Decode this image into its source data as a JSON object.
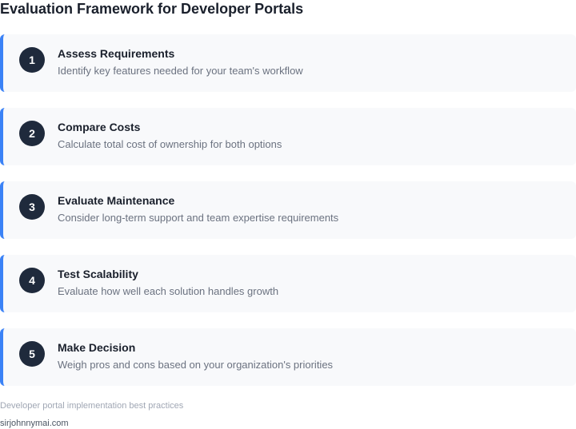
{
  "title": "Evaluation Framework for Developer Portals",
  "steps": [
    {
      "number": "1",
      "title": "Assess Requirements",
      "description": "Identify key features needed for your team's workflow"
    },
    {
      "number": "2",
      "title": "Compare Costs",
      "description": "Calculate total cost of ownership for both options"
    },
    {
      "number": "3",
      "title": "Evaluate Maintenance",
      "description": "Consider long-term support and team expertise requirements"
    },
    {
      "number": "4",
      "title": "Test Scalability",
      "description": "Evaluate how well each solution handles growth"
    },
    {
      "number": "5",
      "title": "Make Decision",
      "description": "Weigh pros and cons based on your organization's priorities"
    }
  ],
  "caption": "Developer portal implementation best practices",
  "source": "sirjohnnymai.com",
  "colors": {
    "accent": "#3b82f6",
    "badge": "#1f2a3c",
    "card_background": "#f8f9fb"
  }
}
